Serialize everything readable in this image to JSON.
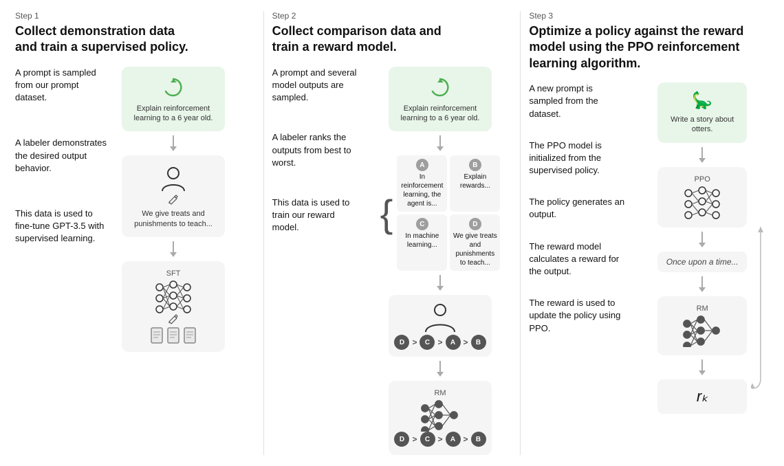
{
  "steps": [
    {
      "label": "Step 1",
      "title": "Collect demonstration data\nand train a supervised policy.",
      "items": [
        {
          "text": "A prompt is sampled from our prompt dataset."
        },
        {
          "text": "A labeler demonstrates the desired output behavior."
        },
        {
          "text": "This data is used to fine-tune GPT-3.5 with supervised learning."
        }
      ],
      "diagram": {
        "card1": {
          "type": "green",
          "label": "Explain reinforcement learning to a 6 year old."
        },
        "card2": {
          "type": "gray",
          "label": "We give treats and punishments to teach..."
        },
        "card3": {
          "type": "gray",
          "sublabel": "SFT",
          "docs": true
        }
      }
    },
    {
      "label": "Step 2",
      "title": "Collect comparison data and\ntrain a reward model.",
      "items": [
        {
          "text": "A prompt and several model outputs are sampled."
        },
        {
          "text": "A labeler ranks the outputs from best to worst."
        },
        {
          "text": "This data is used to train our reward model."
        }
      ],
      "diagram": {
        "prompt_card": {
          "type": "green",
          "label": "Explain reinforcement learning to a 6 year old."
        },
        "outputs": [
          {
            "letter": "A",
            "text": "In reinforcement learning, the agent is..."
          },
          {
            "letter": "B",
            "text": "Explain rewards..."
          },
          {
            "letter": "C",
            "text": "In machine learning..."
          },
          {
            "letter": "D",
            "text": "We give treats and punishments to teach..."
          }
        ],
        "ranking": [
          "D",
          "C",
          "A",
          "B"
        ],
        "rm_label": "RM"
      }
    },
    {
      "label": "Step 3",
      "title": "Optimize a policy against the reward model using the PPO reinforcement learning algorithm.",
      "items": [
        {
          "text": "A new prompt is sampled from the dataset."
        },
        {
          "text": "The PPO model is initialized from the supervised policy."
        },
        {
          "text": "The policy generates an output."
        },
        {
          "text": "The reward model calculates a reward for the output."
        },
        {
          "text": "The reward is used to update the policy using PPO."
        }
      ],
      "diagram": {
        "prompt_card": {
          "type": "green",
          "label": "Write a story about otters."
        },
        "ppo_label": "PPO",
        "output_text": "Once upon a time...",
        "rm_label": "RM",
        "rk_text": "rₖ"
      }
    }
  ]
}
